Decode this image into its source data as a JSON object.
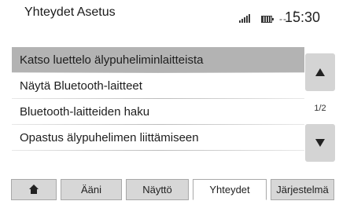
{
  "header": {
    "title": "Yhteydet Asetus",
    "network_text": "--",
    "network_mark": "ᐩ",
    "time": "15:30",
    "icons": [
      "signal-bars-icon",
      "battery-icon",
      "network-icon"
    ]
  },
  "menu": {
    "items": [
      {
        "label": "Katso luettelo älypuheliminlaitteista",
        "selected": true
      },
      {
        "label": "Näytä Bluetooth-laitteet",
        "selected": false
      },
      {
        "label": "Bluetooth-laitteiden haku",
        "selected": false
      },
      {
        "label": "Opastus älypuhelimen liittämiseen",
        "selected": false
      }
    ],
    "page_indicator": "1/2",
    "scroll_icons": [
      "arrow-up-icon",
      "arrow-down-icon"
    ]
  },
  "tabs": {
    "items": [
      {
        "label": "",
        "icon": "home-icon",
        "active": false
      },
      {
        "label": "Ääni",
        "active": false
      },
      {
        "label": "Näyttö",
        "active": false
      },
      {
        "label": "Yhteydet",
        "active": true
      },
      {
        "label": "Järjestelmä",
        "active": false
      }
    ]
  },
  "colors": {
    "selected_row": "#b3b3b3",
    "button_bg": "#d4d4d4",
    "tab_bg": "#d7d7d7",
    "tab_active_bg": "#ffffff"
  }
}
